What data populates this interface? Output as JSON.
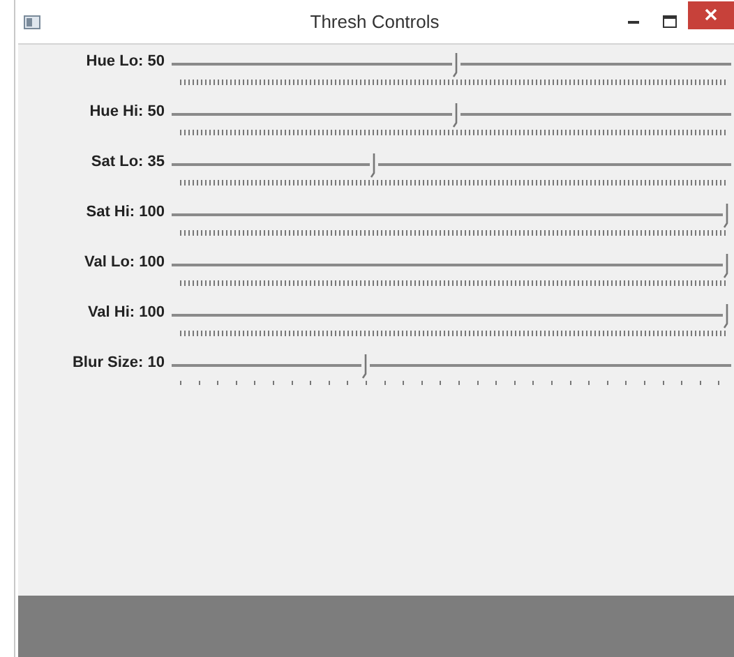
{
  "window": {
    "title": "Thresh Controls"
  },
  "sliders": [
    {
      "label": "Hue Lo: 50",
      "level": 0.51,
      "kind": "fine"
    },
    {
      "label": "Hue Hi: 50",
      "level": 0.51,
      "kind": "fine"
    },
    {
      "label": "Sat Lo: 35",
      "level": 0.36,
      "kind": "fine"
    },
    {
      "label": "Sat Hi: 100",
      "level": 1,
      "kind": "fine"
    },
    {
      "label": "Val Lo: 100",
      "level": 1,
      "kind": "fine"
    },
    {
      "label": "Val Hi: 100",
      "level": 1,
      "kind": "fine"
    },
    {
      "label": "Blur Size: 10",
      "level": 0.345,
      "kind": "coarse"
    }
  ]
}
